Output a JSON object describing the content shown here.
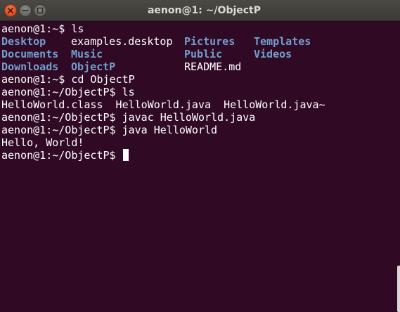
{
  "window": {
    "title": "aenon@1: ~/ObjectP"
  },
  "terminal": {
    "lines": [
      {
        "prompt": "aenon@1:~$ ",
        "command": "ls"
      },
      {
        "listing": [
          "Desktop",
          "examples.desktop",
          "Pictures",
          "Templates"
        ]
      },
      {
        "listing": [
          "Documents",
          "Music",
          "Public",
          "Videos"
        ]
      },
      {
        "listing": [
          "Downloads",
          "ObjectP",
          "README.md",
          ""
        ]
      },
      {
        "prompt": "aenon@1:~$ ",
        "command": "cd ObjectP"
      },
      {
        "prompt": "aenon@1:~/ObjectP$ ",
        "command": "ls"
      },
      {
        "output": "HelloWorld.class  HelloWorld.java  HelloWorld.java~"
      },
      {
        "prompt": "aenon@1:~/ObjectP$ ",
        "command": "javac HelloWorld.java"
      },
      {
        "prompt": "aenon@1:~/ObjectP$ ",
        "command": "java HelloWorld"
      },
      {
        "output": "Hello, World!"
      },
      {
        "prompt": "aenon@1:~/ObjectP$ ",
        "command": ""
      }
    ],
    "directories": [
      "Desktop",
      "Documents",
      "Downloads",
      "Music",
      "ObjectP",
      "Pictures",
      "Public",
      "Templates",
      "Videos"
    ]
  },
  "colors": {
    "background": "#300a24",
    "text": "#ffffff",
    "directory": "#729fcf",
    "titlebar": "#3c3b37",
    "close_button": "#e0521c"
  },
  "icons": {
    "close": "close-icon",
    "minimize": "minimize-icon",
    "maximize": "maximize-icon"
  }
}
